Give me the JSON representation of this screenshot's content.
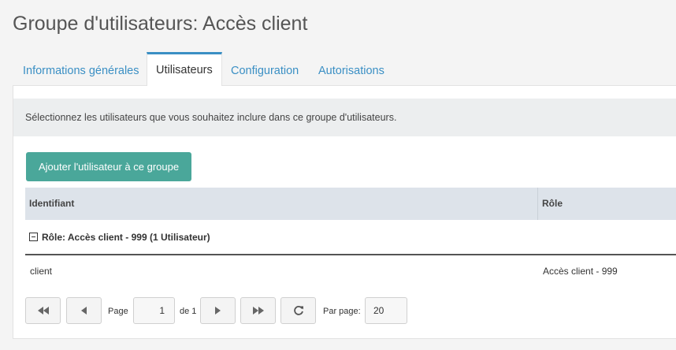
{
  "page": {
    "title": "Groupe d'utilisateurs: Accès client"
  },
  "tabs": [
    {
      "label": "Informations générales"
    },
    {
      "label": "Utilisateurs"
    },
    {
      "label": "Configuration"
    },
    {
      "label": "Autorisations"
    }
  ],
  "info_text": "Sélectionnez les utilisateurs que vous souhaitez inclure dans ce groupe d'utilisateurs.",
  "add_button_label": "Ajouter l'utilisateur à ce groupe",
  "grid": {
    "columns": [
      "Identifiant",
      "Rôle"
    ],
    "group_label": "Rôle: Accès client - 999 (1 Utilisateur)",
    "rows": [
      {
        "identifiant": "client",
        "role": "Accès client - 999"
      }
    ]
  },
  "pager": {
    "page_label": "Page",
    "page_value": "1",
    "of_label": "de 1",
    "per_page_label": "Par page:",
    "per_page_value": "20"
  },
  "icons": [
    "first-page-icon",
    "prev-page-icon",
    "next-page-icon",
    "last-page-icon",
    "refresh-icon",
    "collapse-icon"
  ],
  "colors": {
    "accent": "#3a8fc4",
    "button": "#4aa79a",
    "grid_header": "#dde3ea"
  }
}
